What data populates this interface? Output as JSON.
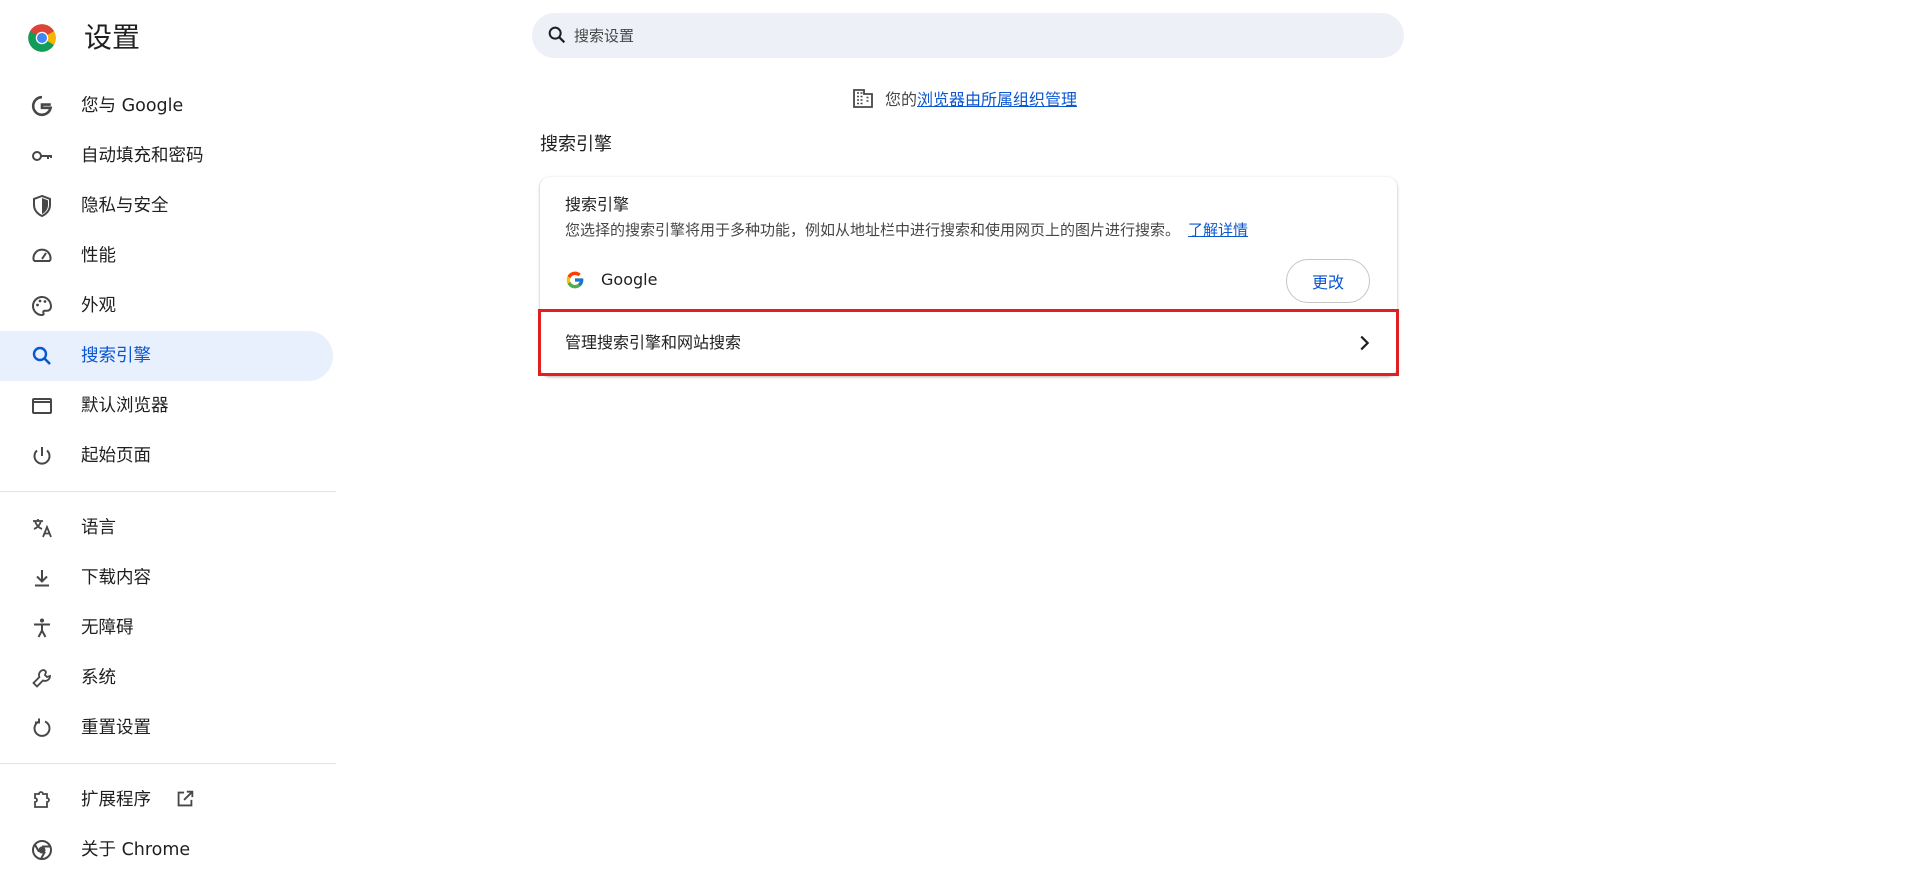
{
  "sidebar": {
    "title": "设置",
    "items": [
      {
        "label": "您与 Google",
        "icon": "google-g-icon"
      },
      {
        "label": "自动填充和密码",
        "icon": "key-icon"
      },
      {
        "label": "隐私与安全",
        "icon": "shield-icon"
      },
      {
        "label": "性能",
        "icon": "speedometer-icon"
      },
      {
        "label": "外观",
        "icon": "palette-icon"
      },
      {
        "label": "搜索引擎",
        "icon": "search-icon",
        "active": true
      },
      {
        "label": "默认浏览器",
        "icon": "browser-window-icon"
      },
      {
        "label": "起始页面",
        "icon": "power-icon"
      },
      {
        "label": "语言",
        "icon": "translate-icon"
      },
      {
        "label": "下载内容",
        "icon": "download-icon"
      },
      {
        "label": "无障碍",
        "icon": "accessibility-icon"
      },
      {
        "label": "系统",
        "icon": "wrench-icon"
      },
      {
        "label": "重置设置",
        "icon": "reset-icon"
      },
      {
        "label": "扩展程序",
        "icon": "puzzle-icon",
        "external_icon": "open-in-new-icon"
      },
      {
        "label": "关于 Chrome",
        "icon": "chrome-icon"
      }
    ]
  },
  "search": {
    "placeholder": "搜索设置"
  },
  "managed_notice": {
    "prefix": "您的",
    "link": "浏览器由所属组织管理",
    "icon": "building-icon"
  },
  "section": {
    "title": "搜索引擎"
  },
  "card": {
    "title": "搜索引擎",
    "description": "您选择的搜索引擎将用于多种功能，例如从地址栏中进行搜索和使用网页上的图片进行搜索。",
    "learn_more": "了解详情",
    "engine_name": "Google",
    "change_label": "更改",
    "manage_label": "管理搜索引擎和网站搜索"
  },
  "colors": {
    "accent": "#0b57d0",
    "active_bg": "#e8effd",
    "search_bg": "#edf0f7",
    "highlight_border": "#e02020"
  }
}
